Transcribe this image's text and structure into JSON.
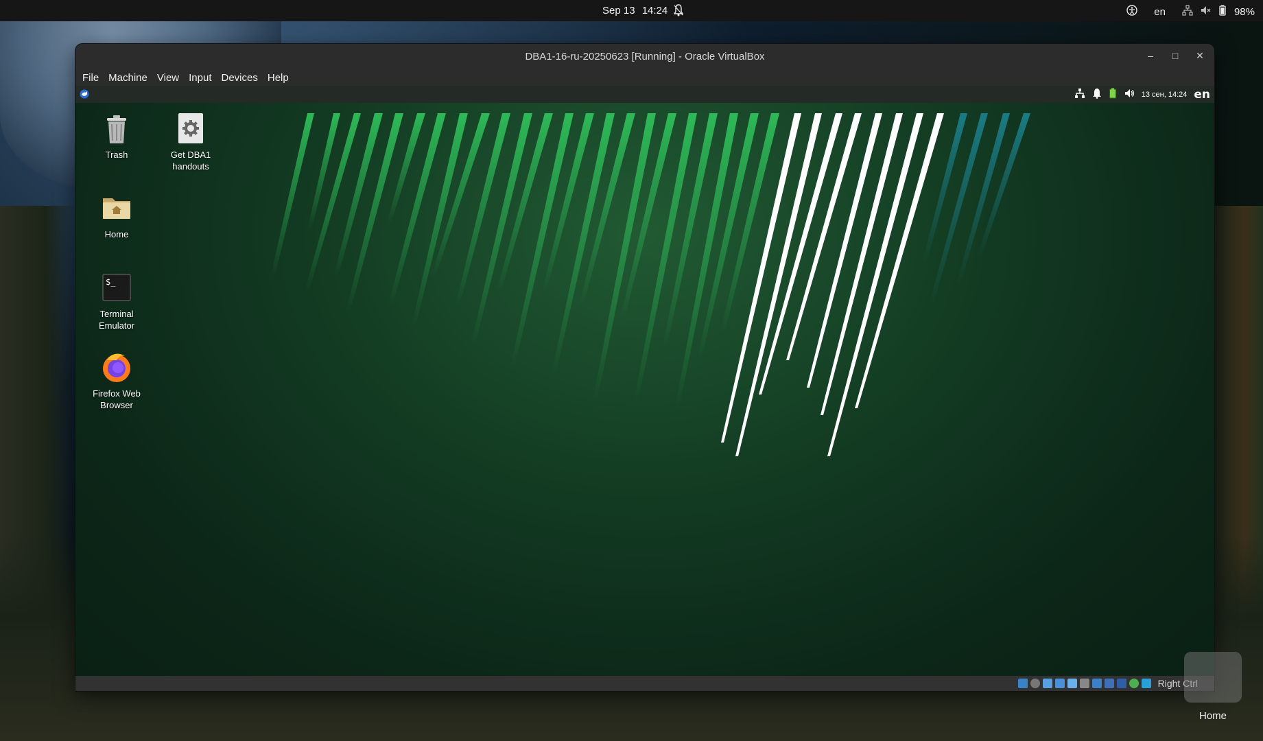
{
  "topbar": {
    "date": "Sep 13",
    "time": "14:24",
    "language": "en",
    "battery": "98%"
  },
  "window": {
    "title": "DBA1-16-ru-20250623 [Running] - Oracle VirtualBox",
    "minimize_icon": "minimize-icon",
    "maximize_icon": "maximize-icon",
    "close_icon": "close-icon"
  },
  "menubar": {
    "items": [
      "File",
      "Machine",
      "View",
      "Input",
      "Devices",
      "Help"
    ]
  },
  "guest": {
    "panel": {
      "datetime": "13 сен, 14:24",
      "language": "en"
    },
    "desktop_icons": [
      {
        "label_line1": "Trash",
        "label_line2": ""
      },
      {
        "label_line1": "Get DBA1",
        "label_line2": "handouts"
      },
      {
        "label_line1": "Home",
        "label_line2": ""
      },
      {
        "label_line1": "Terminal",
        "label_line2": "Emulator"
      },
      {
        "label_line1": "Firefox Web",
        "label_line2": "Browser"
      }
    ]
  },
  "statusbar": {
    "host_key": "Right Ctrl"
  },
  "dock": {
    "tooltip": "Home"
  },
  "colors": {
    "accent_green": "#2fbf5a",
    "accent_teal": "#1b7f8a",
    "guest_bg": "#133c23",
    "host_panel": "#161616"
  }
}
